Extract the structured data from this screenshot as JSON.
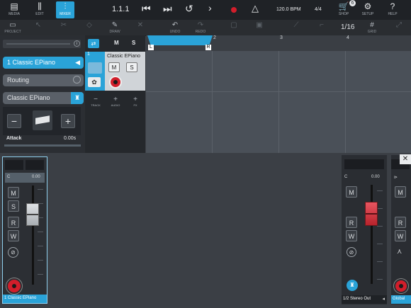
{
  "toolbar": {
    "media_label": "MEDIA",
    "edit_label": "EDIT",
    "mixer_label": "MIXER",
    "position": "1.1.1",
    "tempo": "120.0 BPM",
    "signature": "4/4",
    "shop_label": "SHOP",
    "shop_badge": "6",
    "setup_label": "SETUP",
    "help_label": "HELP"
  },
  "subbar": {
    "project_label": "PROJECT",
    "draw_label": "DRAW",
    "undo_label": "UNDO",
    "redo_label": "REDO",
    "quantize": "1/16",
    "grid_label": "GRID"
  },
  "inspector": {
    "track_name": "1  Classic EPiano",
    "routing_label": "Routing",
    "instrument_name": "Classic EPiano",
    "attack_label": "Attack",
    "attack_value": "0.00s"
  },
  "track": {
    "number": "1",
    "name": "Classic EPiano",
    "mute": "M",
    "solo": "S",
    "track_label": "TRACK",
    "audio_label": "AUDIO",
    "fx_label": "FX"
  },
  "ruler": {
    "bars": [
      "2",
      "3",
      "4"
    ],
    "left_locator": "L",
    "right_locator": "R"
  },
  "channel": {
    "pan_value": "C",
    "volume_value": "0.00",
    "mute": "M",
    "solo": "S",
    "read": "R",
    "write": "W",
    "name": "1 Classic EPiano",
    "volume_level": 0.71
  },
  "output": {
    "pan_value": "C",
    "volume_value": "0.00",
    "mute": "M",
    "read": "R",
    "write": "W",
    "name": "1/2 Stereo Out",
    "volume_level": 0.71
  },
  "global": {
    "name": "Global"
  },
  "colors": {
    "accent": "#2aa3d8",
    "record": "#d21e2b",
    "fader_red": "#d0363e"
  }
}
